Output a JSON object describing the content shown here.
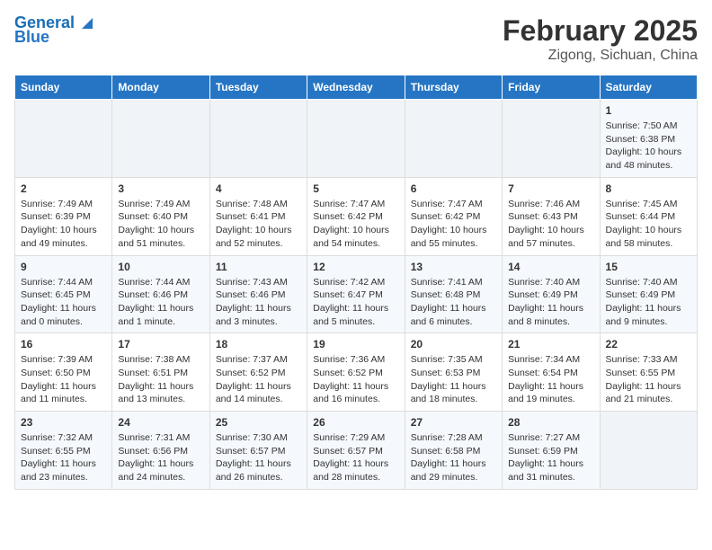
{
  "header": {
    "logo_line1": "General",
    "logo_line2": "Blue",
    "title": "February 2025",
    "subtitle": "Zigong, Sichuan, China"
  },
  "weekdays": [
    "Sunday",
    "Monday",
    "Tuesday",
    "Wednesday",
    "Thursday",
    "Friday",
    "Saturday"
  ],
  "weeks": [
    [
      {
        "day": "",
        "info": ""
      },
      {
        "day": "",
        "info": ""
      },
      {
        "day": "",
        "info": ""
      },
      {
        "day": "",
        "info": ""
      },
      {
        "day": "",
        "info": ""
      },
      {
        "day": "",
        "info": ""
      },
      {
        "day": "1",
        "info": "Sunrise: 7:50 AM\nSunset: 6:38 PM\nDaylight: 10 hours\nand 48 minutes."
      }
    ],
    [
      {
        "day": "2",
        "info": "Sunrise: 7:49 AM\nSunset: 6:39 PM\nDaylight: 10 hours\nand 49 minutes."
      },
      {
        "day": "3",
        "info": "Sunrise: 7:49 AM\nSunset: 6:40 PM\nDaylight: 10 hours\nand 51 minutes."
      },
      {
        "day": "4",
        "info": "Sunrise: 7:48 AM\nSunset: 6:41 PM\nDaylight: 10 hours\nand 52 minutes."
      },
      {
        "day": "5",
        "info": "Sunrise: 7:47 AM\nSunset: 6:42 PM\nDaylight: 10 hours\nand 54 minutes."
      },
      {
        "day": "6",
        "info": "Sunrise: 7:47 AM\nSunset: 6:42 PM\nDaylight: 10 hours\nand 55 minutes."
      },
      {
        "day": "7",
        "info": "Sunrise: 7:46 AM\nSunset: 6:43 PM\nDaylight: 10 hours\nand 57 minutes."
      },
      {
        "day": "8",
        "info": "Sunrise: 7:45 AM\nSunset: 6:44 PM\nDaylight: 10 hours\nand 58 minutes."
      }
    ],
    [
      {
        "day": "9",
        "info": "Sunrise: 7:44 AM\nSunset: 6:45 PM\nDaylight: 11 hours\nand 0 minutes."
      },
      {
        "day": "10",
        "info": "Sunrise: 7:44 AM\nSunset: 6:46 PM\nDaylight: 11 hours\nand 1 minute."
      },
      {
        "day": "11",
        "info": "Sunrise: 7:43 AM\nSunset: 6:46 PM\nDaylight: 11 hours\nand 3 minutes."
      },
      {
        "day": "12",
        "info": "Sunrise: 7:42 AM\nSunset: 6:47 PM\nDaylight: 11 hours\nand 5 minutes."
      },
      {
        "day": "13",
        "info": "Sunrise: 7:41 AM\nSunset: 6:48 PM\nDaylight: 11 hours\nand 6 minutes."
      },
      {
        "day": "14",
        "info": "Sunrise: 7:40 AM\nSunset: 6:49 PM\nDaylight: 11 hours\nand 8 minutes."
      },
      {
        "day": "15",
        "info": "Sunrise: 7:40 AM\nSunset: 6:49 PM\nDaylight: 11 hours\nand 9 minutes."
      }
    ],
    [
      {
        "day": "16",
        "info": "Sunrise: 7:39 AM\nSunset: 6:50 PM\nDaylight: 11 hours\nand 11 minutes."
      },
      {
        "day": "17",
        "info": "Sunrise: 7:38 AM\nSunset: 6:51 PM\nDaylight: 11 hours\nand 13 minutes."
      },
      {
        "day": "18",
        "info": "Sunrise: 7:37 AM\nSunset: 6:52 PM\nDaylight: 11 hours\nand 14 minutes."
      },
      {
        "day": "19",
        "info": "Sunrise: 7:36 AM\nSunset: 6:52 PM\nDaylight: 11 hours\nand 16 minutes."
      },
      {
        "day": "20",
        "info": "Sunrise: 7:35 AM\nSunset: 6:53 PM\nDaylight: 11 hours\nand 18 minutes."
      },
      {
        "day": "21",
        "info": "Sunrise: 7:34 AM\nSunset: 6:54 PM\nDaylight: 11 hours\nand 19 minutes."
      },
      {
        "day": "22",
        "info": "Sunrise: 7:33 AM\nSunset: 6:55 PM\nDaylight: 11 hours\nand 21 minutes."
      }
    ],
    [
      {
        "day": "23",
        "info": "Sunrise: 7:32 AM\nSunset: 6:55 PM\nDaylight: 11 hours\nand 23 minutes."
      },
      {
        "day": "24",
        "info": "Sunrise: 7:31 AM\nSunset: 6:56 PM\nDaylight: 11 hours\nand 24 minutes."
      },
      {
        "day": "25",
        "info": "Sunrise: 7:30 AM\nSunset: 6:57 PM\nDaylight: 11 hours\nand 26 minutes."
      },
      {
        "day": "26",
        "info": "Sunrise: 7:29 AM\nSunset: 6:57 PM\nDaylight: 11 hours\nand 28 minutes."
      },
      {
        "day": "27",
        "info": "Sunrise: 7:28 AM\nSunset: 6:58 PM\nDaylight: 11 hours\nand 29 minutes."
      },
      {
        "day": "28",
        "info": "Sunrise: 7:27 AM\nSunset: 6:59 PM\nDaylight: 11 hours\nand 31 minutes."
      },
      {
        "day": "",
        "info": ""
      }
    ]
  ]
}
